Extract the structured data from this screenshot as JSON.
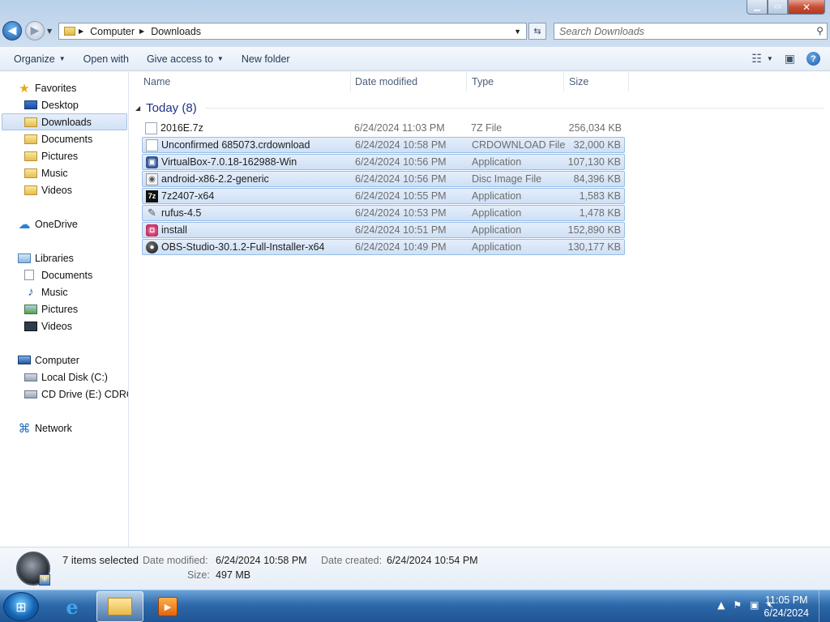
{
  "window": {
    "min_label": "▁",
    "max_label": "▭",
    "close_label": "✕"
  },
  "address": {
    "crumbs": [
      "Computer",
      "Downloads"
    ]
  },
  "search": {
    "placeholder": "Search Downloads"
  },
  "toolbar": {
    "organize": "Organize",
    "open_with": "Open with",
    "give_access": "Give access to",
    "new_folder": "New folder"
  },
  "sidebar": {
    "favorites": "Favorites",
    "desktop": "Desktop",
    "downloads": "Downloads",
    "documents": "Documents",
    "pictures": "Pictures",
    "music": "Music",
    "videos": "Videos",
    "onedrive": "OneDrive",
    "libraries": "Libraries",
    "lib_documents": "Documents",
    "lib_music": "Music",
    "lib_pictures": "Pictures",
    "lib_videos": "Videos",
    "computer": "Computer",
    "local_disk": "Local Disk (C:)",
    "cd_drive": "CD Drive (E:) CDROM",
    "network": "Network"
  },
  "columns": {
    "name": "Name",
    "date": "Date modified",
    "type": "Type",
    "size": "Size"
  },
  "group": {
    "label": "Today (8)"
  },
  "files": [
    {
      "name": "2016E.7z",
      "date": "6/24/2024 11:03 PM",
      "type": "7Z File",
      "size": "256,034 KB",
      "icon": "file-icon",
      "selected": false
    },
    {
      "name": "Unconfirmed 685073.crdownload",
      "date": "6/24/2024 10:58 PM",
      "type": "CRDOWNLOAD File",
      "size": "32,000 KB",
      "icon": "file-icon",
      "selected": true
    },
    {
      "name": "VirtualBox-7.0.18-162988-Win",
      "date": "6/24/2024 10:56 PM",
      "type": "Application",
      "size": "107,130 KB",
      "icon": "virtualbox-icon",
      "selected": true
    },
    {
      "name": "android-x86-2.2-generic",
      "date": "6/24/2024 10:56 PM",
      "type": "Disc Image File",
      "size": "84,396 KB",
      "icon": "disc-image-icon",
      "selected": true
    },
    {
      "name": "7z2407-x64",
      "date": "6/24/2024 10:55 PM",
      "type": "Application",
      "size": "1,583 KB",
      "icon": "7zip-icon",
      "selected": true
    },
    {
      "name": "rufus-4.5",
      "date": "6/24/2024 10:53 PM",
      "type": "Application",
      "size": "1,478 KB",
      "icon": "rufus-icon",
      "selected": true
    },
    {
      "name": "install",
      "date": "6/24/2024 10:51 PM",
      "type": "Application",
      "size": "152,890 KB",
      "icon": "installer-icon",
      "selected": true
    },
    {
      "name": "OBS-Studio-30.1.2-Full-Installer-x64",
      "date": "6/24/2024 10:49 PM",
      "type": "Application",
      "size": "130,177 KB",
      "icon": "obs-icon",
      "selected": true
    }
  ],
  "details": {
    "count": "7 items selected",
    "date_modified_label": "Date modified:",
    "date_modified": "6/24/2024 10:58 PM",
    "date_created_label": "Date created:",
    "date_created": "6/24/2024 10:54 PM",
    "size_label": "Size:",
    "size": "497 MB"
  },
  "clock": {
    "time": "11:05 PM",
    "date": "6/24/2024"
  },
  "colors": {
    "selection": "#cfe0f5",
    "selection_border": "#97bde8",
    "group_header": "#1e3287",
    "taskbar": "#2e69aa"
  }
}
